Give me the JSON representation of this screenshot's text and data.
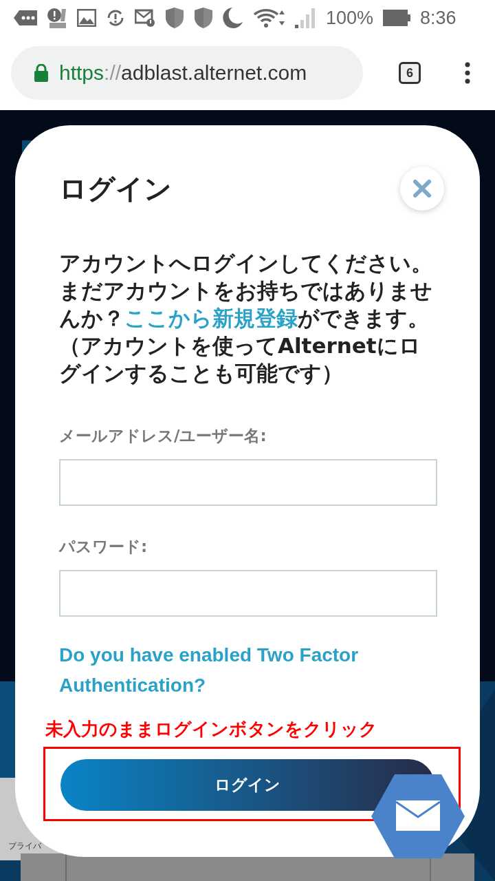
{
  "status_bar": {
    "battery": "100%",
    "time": "8:36"
  },
  "browser": {
    "url_scheme": "https",
    "url_sep": "://",
    "url_host": "adblast.alternet.com",
    "tab_count": "6"
  },
  "background": {
    "footer_text": "プライバ"
  },
  "modal": {
    "title": "ログイン",
    "intro_before": "アカウントへログインしてください。まだアカウントをお持ちではありませんか？",
    "intro_link": "ここから新規登録",
    "intro_after": "ができます。（アカウントを使ってAlternetにログインすることも可能です）",
    "fields": [
      {
        "label": "メールアドレス/ユーザー名:"
      },
      {
        "label": "パスワード:"
      }
    ],
    "two_factor_link": "Do you have enabled Two Factor Authentication?",
    "login_button": "ログイン"
  },
  "annotation": {
    "text": "未入力のままログインボタンをクリック"
  }
}
